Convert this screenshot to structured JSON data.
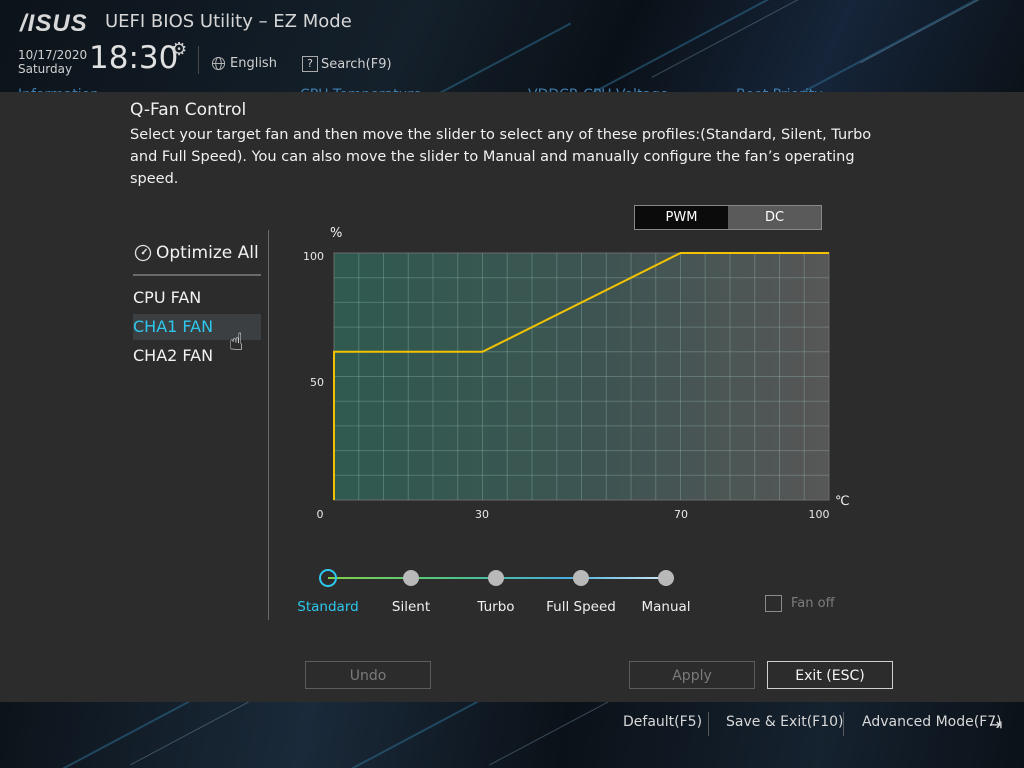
{
  "header": {
    "logo": "/ISUS",
    "app_title": "UEFI BIOS Utility – EZ Mode",
    "date": "10/17/2020",
    "day": "Saturday",
    "time": "18:30",
    "language": "English",
    "search": "Search(F9)",
    "tabs_partial": [
      "Information",
      "CPU Temperature",
      "VDDCR CPU Voltage",
      "Boot Priority"
    ]
  },
  "panel": {
    "title": "Q-Fan Control",
    "description": "Select your target fan and then move the slider to select any of these profiles:(Standard, Silent, Turbo and Full Speed). You can also move the slider to Manual and manually configure the fan’s operating speed."
  },
  "mode_toggle": {
    "pwm": "PWM",
    "dc": "DC",
    "selected": "PWM"
  },
  "fans": {
    "optimize_all": "Optimize All",
    "items": [
      "CPU FAN",
      "CHA1 FAN",
      "CHA2 FAN"
    ],
    "selected": "CHA1 FAN"
  },
  "chart_data": {
    "type": "line",
    "x_unit": "℃",
    "y_unit": "%",
    "x_ticks": [
      "0",
      "30",
      "70",
      "100"
    ],
    "y_ticks": [
      "100",
      "50"
    ],
    "xlim": [
      0,
      100
    ],
    "ylim": [
      0,
      100
    ],
    "grid": true,
    "series": [
      {
        "color": "#f2c200",
        "x": [
          0,
          0,
          30,
          70,
          100
        ],
        "y": [
          0,
          60,
          60,
          100,
          100
        ]
      }
    ]
  },
  "profiles": {
    "items": [
      "Standard",
      "Silent",
      "Turbo",
      "Full Speed",
      "Manual"
    ],
    "selected": "Standard",
    "fan_off": "Fan off"
  },
  "buttons": {
    "undo": "Undo",
    "apply": "Apply",
    "exit": "Exit (ESC)"
  },
  "footer": {
    "default": "Default(F5)",
    "save_exit": "Save & Exit(F10)",
    "advanced": "Advanced Mode(F7)"
  },
  "colors": {
    "accent": "#2ec8ee",
    "curve": "#f2c200"
  }
}
